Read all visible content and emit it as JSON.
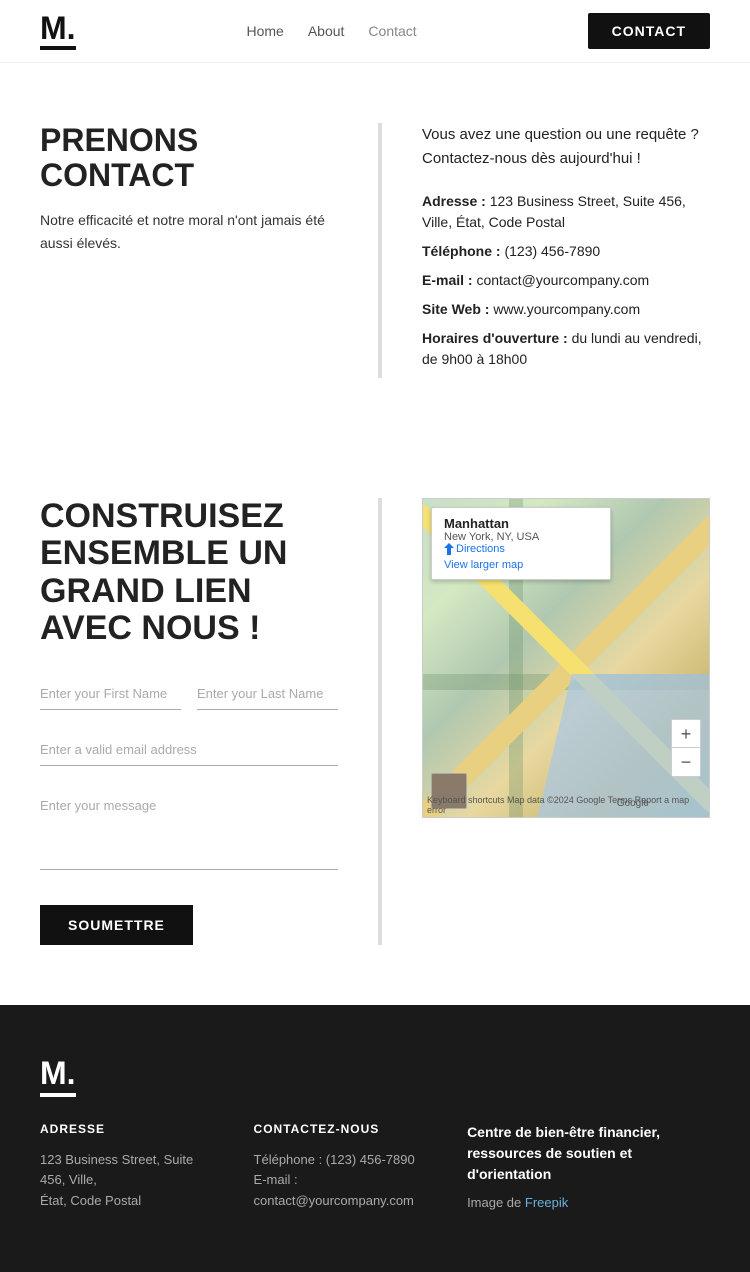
{
  "header": {
    "logo": "M.",
    "nav": {
      "home": "Home",
      "about": "About",
      "contact": "Contact"
    },
    "cta_label": "CONTACT"
  },
  "section1": {
    "left": {
      "title": "PRENONS CONTACT",
      "description": "Notre efficacité et notre moral n'ont jamais été aussi élevés."
    },
    "right": {
      "intro": "Vous avez une question ou une requête ? Contactez-nous dès aujourd'hui !",
      "address_label": "Adresse :",
      "address_value": "123 Business Street, Suite 456, Ville, État, Code Postal",
      "phone_label": "Téléphone :",
      "phone_value": "(123) 456-7890",
      "email_label": "E-mail :",
      "email_value": "contact@yourcompany.com",
      "website_label": "Site Web :",
      "website_value": "www.yourcompany.com",
      "hours_label": "Horaires d'ouverture :",
      "hours_value": "du lundi au vendredi, de 9h00 à 18h00"
    }
  },
  "section2": {
    "left": {
      "title": "CONSTRUISEZ ENSEMBLE UN GRAND LIEN AVEC NOUS !",
      "form": {
        "first_name_placeholder": "Enter your First Name",
        "last_name_placeholder": "Enter your Last Name",
        "email_placeholder": "Enter a valid email address",
        "message_placeholder": "Enter your message",
        "submit_label": "SOUMETTRE"
      }
    },
    "right": {
      "map": {
        "place_name": "Manhattan",
        "place_location": "New York, NY, USA",
        "directions_label": "Directions",
        "larger_map_label": "View larger map",
        "zoom_in": "+",
        "zoom_out": "−",
        "attribution": "Keyboard shortcuts  Map data ©2024 Google  Terms  Report a map error"
      }
    }
  },
  "footer": {
    "logo": "M.",
    "address_col": {
      "title": "ADRESSE",
      "line1": "123 Business Street, Suite 456, Ville,",
      "line2": "État, Code Postal"
    },
    "contact_col": {
      "title": "CONTACTEZ-NOUS",
      "phone": "Téléphone : (123) 456-7890",
      "email": "E-mail : contact@yourcompany.com"
    },
    "right_col": {
      "title": "Centre de bien-être financier, ressources de soutien et d'orientation",
      "credit_prefix": "Image de ",
      "credit_link": "Freepik"
    }
  }
}
